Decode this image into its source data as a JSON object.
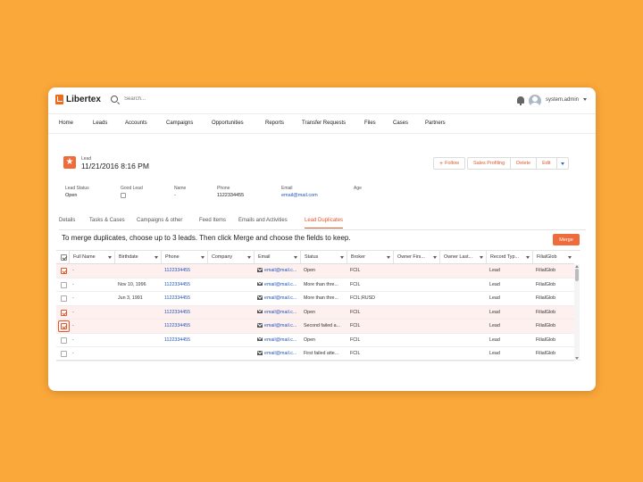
{
  "app": {
    "name": "Libertex"
  },
  "search": {
    "placeholder": "Search..."
  },
  "user": {
    "name": "system.admin"
  },
  "nav": [
    "Home",
    "Leads",
    "Accounts",
    "Campaigns",
    "Opportunities",
    "Reports",
    "Transfer Requests",
    "Files",
    "Cases",
    "Partners"
  ],
  "record": {
    "type": "Lead",
    "title": "11/21/2016 8:16 PM",
    "icon": "star-icon"
  },
  "actions": {
    "follow": "Follow",
    "sales_profiling": "Sales Profiling",
    "delete": "Delete",
    "edit": "Edit"
  },
  "fields": [
    {
      "label": "Lead Status",
      "value": "Open"
    },
    {
      "label": "Good Lead",
      "value": ""
    },
    {
      "label": "Name",
      "value": "-"
    },
    {
      "label": "Phone",
      "value": "1122334455"
    },
    {
      "label": "Email",
      "value": "email@mail.com"
    },
    {
      "label": "Age",
      "value": ""
    }
  ],
  "tabs": [
    "Details",
    "Tasks & Cases",
    "Campaigns & other",
    "Feed Items",
    "Emails and Activities",
    "Lead Duplicates"
  ],
  "active_tab": "Lead Duplicates",
  "instruction": "To merge duplicates, choose up to 3 leads. Then click Merge and choose the fields to keep.",
  "merge_label": "Merge",
  "table": {
    "columns": [
      "Full Name",
      "Birthdate",
      "Phone",
      "Company",
      "Email",
      "Status",
      "Broker",
      "Owner Firs...",
      "Owner Last...",
      "Record Typ...",
      "FilialGlob"
    ],
    "rows": [
      {
        "checked": true,
        "name": "-",
        "birthdate": "",
        "phone": "1122334455",
        "company": "",
        "email": "email@mail.c...",
        "status": "Open",
        "broker": "FCIL",
        "owner_first": "",
        "owner_last": "",
        "record_type": "Lead",
        "filial": "FilialGlob"
      },
      {
        "checked": false,
        "name": "-",
        "birthdate": "Nov 10, 1996",
        "phone": "1122334455",
        "company": "",
        "email": "email@mail.c...",
        "status": "More than thre...",
        "broker": "FCIL",
        "owner_first": "",
        "owner_last": "",
        "record_type": "Lead",
        "filial": "FilialGlob"
      },
      {
        "checked": false,
        "name": "-",
        "birthdate": "Jun 3, 1991",
        "phone": "1122334455",
        "company": "",
        "email": "email@mail.c...",
        "status": "More than thre...",
        "broker": "FCIL;RUSD",
        "owner_first": "",
        "owner_last": "",
        "record_type": "Lead",
        "filial": "FilialGlob"
      },
      {
        "checked": true,
        "name": "-",
        "birthdate": "",
        "phone": "1122334455",
        "company": "",
        "email": "email@mail.c...",
        "status": "Open",
        "broker": "FCIL",
        "owner_first": "",
        "owner_last": "",
        "record_type": "Lead",
        "filial": "FilialGlob"
      },
      {
        "checked": true,
        "name": "-",
        "birthdate": "",
        "phone": "1122334455",
        "company": "",
        "email": "email@mail.c...",
        "status": "Second failed a...",
        "broker": "FCIL",
        "owner_first": "",
        "owner_last": "",
        "record_type": "Lead",
        "filial": "FilialGlob"
      },
      {
        "checked": false,
        "name": "-",
        "birthdate": "",
        "phone": "1122334455",
        "company": "",
        "email": "email@mail.c...",
        "status": "Open",
        "broker": "FCIL",
        "owner_first": "",
        "owner_last": "",
        "record_type": "Lead",
        "filial": "FilialGlob"
      },
      {
        "checked": false,
        "name": "-",
        "birthdate": "",
        "phone": "",
        "company": "",
        "email": "email@mail.c...",
        "status": "First failed atte...",
        "broker": "FCIL",
        "owner_first": "",
        "owner_last": "",
        "record_type": "Lead",
        "filial": "FilialGlob"
      }
    ]
  },
  "colors": {
    "background": "#FBA83A",
    "accent": "#E0572D",
    "link": "#2255B8",
    "merge_button": "#EF6C3A"
  }
}
